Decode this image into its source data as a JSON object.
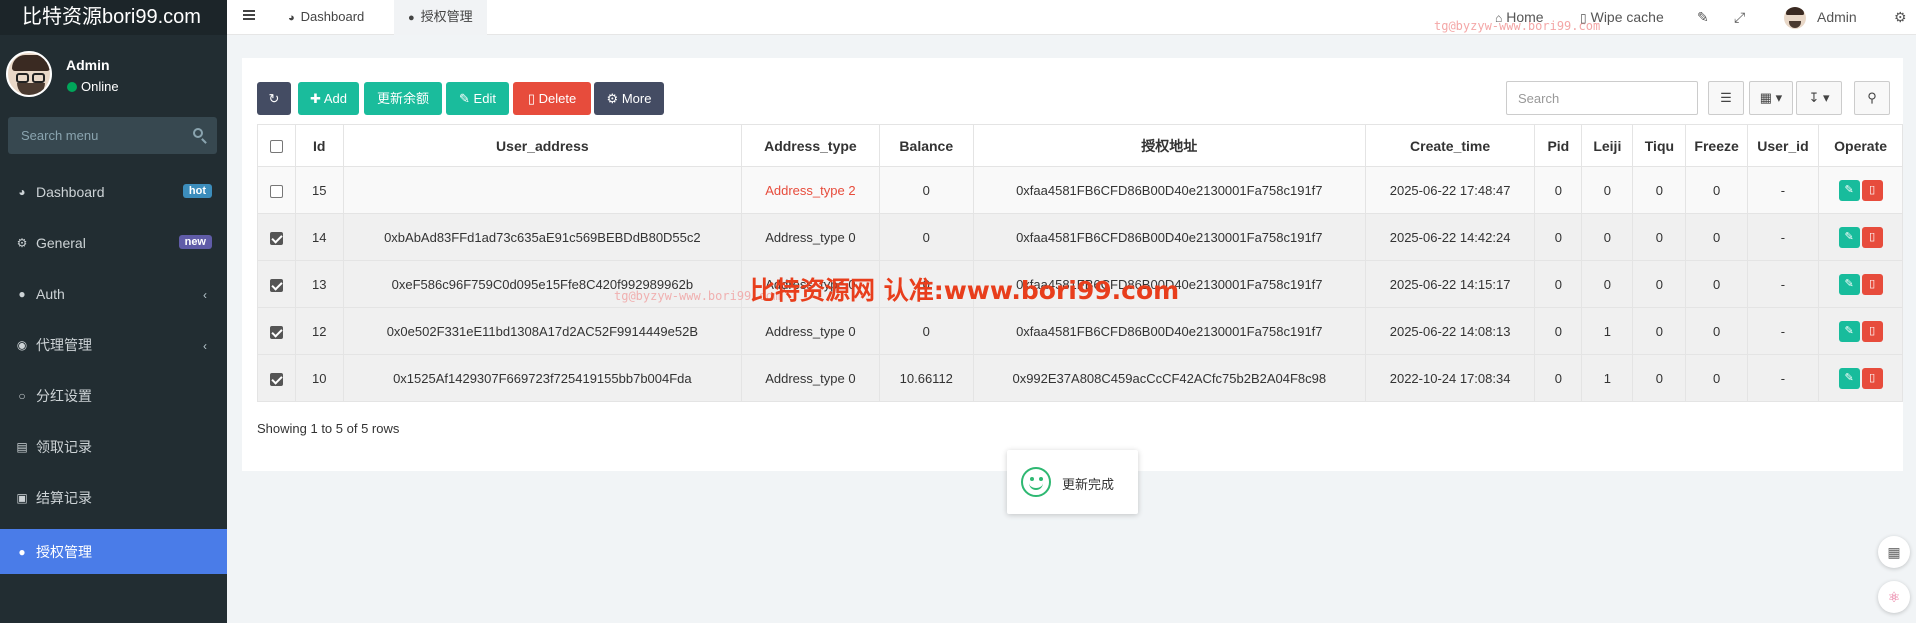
{
  "sidebar": {
    "logo": "比特资源bori99.com",
    "user": {
      "name": "Admin",
      "status": "Online"
    },
    "search_placeholder": "Search menu",
    "items": [
      {
        "label": "Dashboard",
        "icon": "dashboard-icon",
        "badge": "hot"
      },
      {
        "label": "General",
        "icon": "cogs-icon",
        "badge": "new"
      },
      {
        "label": "Auth",
        "icon": "users-icon",
        "chevron": true
      },
      {
        "label": "代理管理",
        "icon": "user-circle-icon",
        "chevron": true
      },
      {
        "label": "分红设置",
        "icon": "circle-icon"
      },
      {
        "label": "领取记录",
        "icon": "bank-icon"
      },
      {
        "label": "结算记录",
        "icon": "money-icon"
      },
      {
        "label": "授权管理",
        "icon": "users-icon",
        "active": true
      }
    ]
  },
  "topbar": {
    "tabs": [
      {
        "label": "Dashboard",
        "icon": "dashboard-icon"
      },
      {
        "label": "授权管理",
        "icon": "users-icon",
        "active": true
      }
    ],
    "watermark": "tg@byzyw-www.bori99.com",
    "home": "Home",
    "wipe_cache": "Wipe cache",
    "admin": "Admin"
  },
  "toolbar": {
    "add": "Add",
    "update_balance": "更新余额",
    "edit": "Edit",
    "delete": "Delete",
    "more": "More",
    "search_placeholder": "Search"
  },
  "table": {
    "headers": [
      "Id",
      "User_address",
      "Address_type",
      "Balance",
      "授权地址",
      "Create_time",
      "Pid",
      "Leiji",
      "Tiqu",
      "Freeze",
      "User_id",
      "Operate"
    ],
    "rows": [
      {
        "checked": false,
        "id": "15",
        "user_address": "",
        "address_type": "Address_type 2",
        "balance": "0",
        "auth_address": "0xfaa4581FB6CFD86B00D40e2130001Fa758c191f7",
        "create_time": "2025-06-22 17:48:47",
        "pid": "0",
        "leiji": "0",
        "tiqu": "0",
        "freeze": "0",
        "user_id": "-"
      },
      {
        "checked": true,
        "id": "14",
        "user_address": "0xbAbAd83FFd1ad73c635aE91c569BEBDdB80D55c2",
        "address_type": "Address_type 0",
        "balance": "0",
        "auth_address": "0xfaa4581FB6CFD86B00D40e2130001Fa758c191f7",
        "create_time": "2025-06-22 14:42:24",
        "pid": "0",
        "leiji": "0",
        "tiqu": "0",
        "freeze": "0",
        "user_id": "-"
      },
      {
        "checked": true,
        "id": "13",
        "user_address": "0xeF586c96F759C0d095e15Ffe8C420f992989962b",
        "address_type": "Address_type 0",
        "balance": "0",
        "auth_address": "0xfaa4581FB6CFD86B00D40e2130001Fa758c191f7",
        "create_time": "2025-06-22 14:15:17",
        "pid": "0",
        "leiji": "0",
        "tiqu": "0",
        "freeze": "0",
        "user_id": "-"
      },
      {
        "checked": true,
        "id": "12",
        "user_address": "0x0e502F331eE11bd1308A17d2AC52F9914449e52B",
        "address_type": "Address_type 0",
        "balance": "0",
        "auth_address": "0xfaa4581FB6CFD86B00D40e2130001Fa758c191f7",
        "create_time": "2025-06-22 14:08:13",
        "pid": "0",
        "leiji": "1",
        "tiqu": "0",
        "freeze": "0",
        "user_id": "-"
      },
      {
        "checked": true,
        "id": "10",
        "user_address": "0x1525Af1429307F669723f725419155bb7b004Fda",
        "address_type": "Address_type 0",
        "balance": "10.66112",
        "auth_address": "0x992E37A808C459acCcCF42ACfc75b2B2A04F8c98",
        "create_time": "2022-10-24 17:08:34",
        "pid": "0",
        "leiji": "1",
        "tiqu": "0",
        "freeze": "0",
        "user_id": "-"
      }
    ]
  },
  "pagination_text": "Showing 1 to 5 of 5 rows",
  "overlay_text": "比特资源网 认准:www.bori99.com",
  "overlay_small": "tg@byzyw-www.bori99.com",
  "toast": "更新完成",
  "colors": {
    "sidebar_bg": "#222d32",
    "active_menu": "#4a7ce8",
    "teal": "#1abc9c",
    "red": "#e74c3c",
    "dark_btn": "#444c63"
  }
}
